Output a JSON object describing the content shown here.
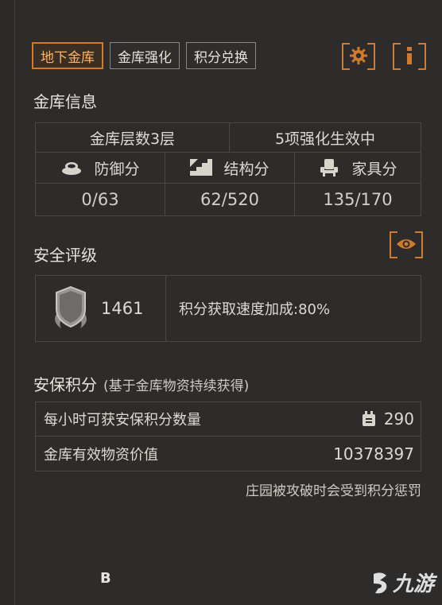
{
  "tabs": [
    {
      "label": "地下金库",
      "active": true
    },
    {
      "label": "金库强化",
      "active": false
    },
    {
      "label": "积分兑换",
      "active": false
    }
  ],
  "toolbar": {
    "settings_icon": "gear-icon",
    "info_icon": "info-icon"
  },
  "vault_info": {
    "title": "金库信息",
    "floors": "金库层数3层",
    "upgrades": "5项强化生效中",
    "stats": [
      {
        "label": "防御分",
        "icon": "defense-icon",
        "value": "0/63"
      },
      {
        "label": "结构分",
        "icon": "stairs-icon",
        "value": "62/520"
      },
      {
        "label": "家具分",
        "icon": "chair-icon",
        "value": "135/170"
      }
    ]
  },
  "safety_rating": {
    "title": "安全评级",
    "grade": "B",
    "score": "1461",
    "bonus_text": "积分获取速度加成:80%",
    "view_icon": "eye-icon"
  },
  "security_points": {
    "title": "安保积分",
    "subtitle": "(基于金库物资持续获得)",
    "rows": [
      {
        "label": "每小时可获安保积分数量",
        "value": "290",
        "icon": "points-icon"
      },
      {
        "label": "金库有效物资价值",
        "value": "10378397"
      }
    ],
    "penalty_note": "庄园被攻破时会受到积分惩罚"
  },
  "watermark": {
    "text": "九游"
  },
  "colors": {
    "accent": "#d07a2c",
    "background": "#2d2c2b",
    "border": "#4a4845"
  }
}
